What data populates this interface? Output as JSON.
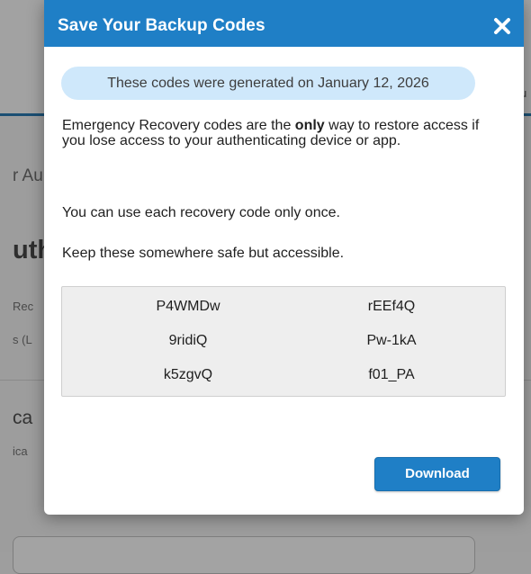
{
  "background": {
    "tab_partial": "u",
    "section_partial": "r Au",
    "heading_partial": "uth",
    "small_line_1": "Rec",
    "small_line_2": "s (L",
    "subheading_partial": "ca",
    "small_line_3": "ica"
  },
  "modal": {
    "title": "Save Your Backup Codes",
    "close_icon": "close-icon",
    "generated_notice": "These codes were generated on January 12, 2026",
    "para1_before": "Emergency Recovery codes are the ",
    "para1_bold": "only",
    "para1_after": " way to restore access if you lose access to your authenticating device or app.",
    "para2": "You can use each recovery code only once.",
    "para3": "Keep these somewhere safe but accessible.",
    "codes": [
      [
        "P4WMDw",
        "rEEf4Q"
      ],
      [
        "9ridiQ",
        "Pw-1kA"
      ],
      [
        "k5zgvQ",
        "f01_PA"
      ]
    ],
    "download_label": "Download"
  },
  "colors": {
    "header_blue": "#1f7fc6",
    "pill_bg": "#cfe8fb",
    "codes_bg": "#eeeeee",
    "overlay_gray": "#9e9e9e"
  }
}
